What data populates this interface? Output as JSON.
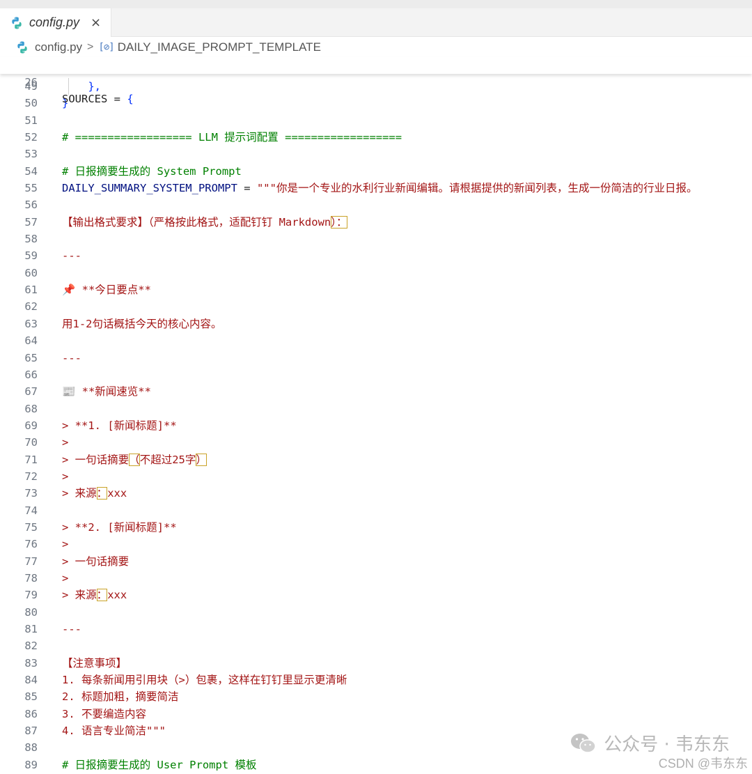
{
  "tab": {
    "label": "config.py",
    "close": "×"
  },
  "breadcrumb": {
    "file": "config.py",
    "separator": ">",
    "symbol": "DAILY_IMAGE_PROMPT_TEMPLATE"
  },
  "sticky": {
    "num": "26",
    "text": "SOURCES = {"
  },
  "lines": [
    {
      "num": "49",
      "text": "    },",
      "cls": "c-brace"
    },
    {
      "num": "50",
      "text": "}",
      "cls": "c-brace"
    },
    {
      "num": "51",
      "text": ""
    },
    {
      "num": "52",
      "text": "# ================== LLM 提示词配置 ==================",
      "cls": "c-com"
    },
    {
      "num": "53",
      "text": ""
    },
    {
      "num": "54",
      "text": "# 日报摘要生成的 System Prompt",
      "cls": "c-com"
    },
    {
      "num": "55",
      "pre": "DAILY_SUMMARY_SYSTEM_PROMPT",
      "eq": " = ",
      "text": "\"\"\"你是一个专业的水利行业新闻编辑。请根据提供的新闻列表，生成一份简洁的行业日报。",
      "cls": "c-str"
    },
    {
      "num": "56",
      "text": ""
    },
    {
      "num": "57",
      "text": "【输出格式要求】（严格按此格式，适配钉钉 Markdown",
      "hl": "）：",
      "cls": "c-str"
    },
    {
      "num": "58",
      "text": ""
    },
    {
      "num": "59",
      "text": "---",
      "cls": "c-str"
    },
    {
      "num": "60",
      "text": ""
    },
    {
      "num": "61",
      "text": "📌 **今日要点**",
      "cls": "c-str"
    },
    {
      "num": "62",
      "text": ""
    },
    {
      "num": "63",
      "text": "用1-2句话概括今天的核心内容。",
      "cls": "c-str"
    },
    {
      "num": "64",
      "text": ""
    },
    {
      "num": "65",
      "text": "---",
      "cls": "c-str"
    },
    {
      "num": "66",
      "text": ""
    },
    {
      "num": "67",
      "text": "📰 **新闻速览**",
      "cls": "c-str"
    },
    {
      "num": "68",
      "text": ""
    },
    {
      "num": "69",
      "text": "> **1. [新闻标题]**",
      "cls": "c-str"
    },
    {
      "num": "70",
      "text": ">",
      "cls": "c-str"
    },
    {
      "num": "71",
      "text": "> 一句话摘要",
      "hl": "（",
      "post": "不超过25字",
      "hl2": "）",
      "cls": "c-str"
    },
    {
      "num": "72",
      "text": ">",
      "cls": "c-str"
    },
    {
      "num": "73",
      "text": "> 来源",
      "hl": "：",
      "post": "xxx",
      "cls": "c-str"
    },
    {
      "num": "74",
      "text": ""
    },
    {
      "num": "75",
      "text": "> **2. [新闻标题]**",
      "cls": "c-str"
    },
    {
      "num": "76",
      "text": ">",
      "cls": "c-str"
    },
    {
      "num": "77",
      "text": "> 一句话摘要",
      "cls": "c-str"
    },
    {
      "num": "78",
      "text": ">",
      "cls": "c-str"
    },
    {
      "num": "79",
      "text": "> 来源",
      "hl": "：",
      "post": "xxx",
      "cls": "c-str"
    },
    {
      "num": "80",
      "text": ""
    },
    {
      "num": "81",
      "text": "---",
      "cls": "c-str"
    },
    {
      "num": "82",
      "text": ""
    },
    {
      "num": "83",
      "text": "【注意事项】",
      "cls": "c-str"
    },
    {
      "num": "84",
      "text": "1. 每条新闻用引用块（>）包裹，这样在钉钉里显示更清晰",
      "cls": "c-str"
    },
    {
      "num": "85",
      "text": "2. 标题加粗，摘要简洁",
      "cls": "c-str"
    },
    {
      "num": "86",
      "text": "3. 不要编造内容",
      "cls": "c-str"
    },
    {
      "num": "87",
      "text": "4. 语言专业简洁\"\"\"",
      "cls": "c-str"
    },
    {
      "num": "88",
      "text": ""
    },
    {
      "num": "89",
      "text": "# 日报摘要生成的 User Prompt 模板",
      "cls": "c-com"
    }
  ],
  "watermark": {
    "text": "公众号 · 韦东东",
    "csdn": "CSDN @韦东东"
  },
  "colors": {
    "string": "#a31515",
    "comment": "#008000",
    "variable": "#001080",
    "brace": "#0431fa",
    "highlight": "#c9a227"
  }
}
